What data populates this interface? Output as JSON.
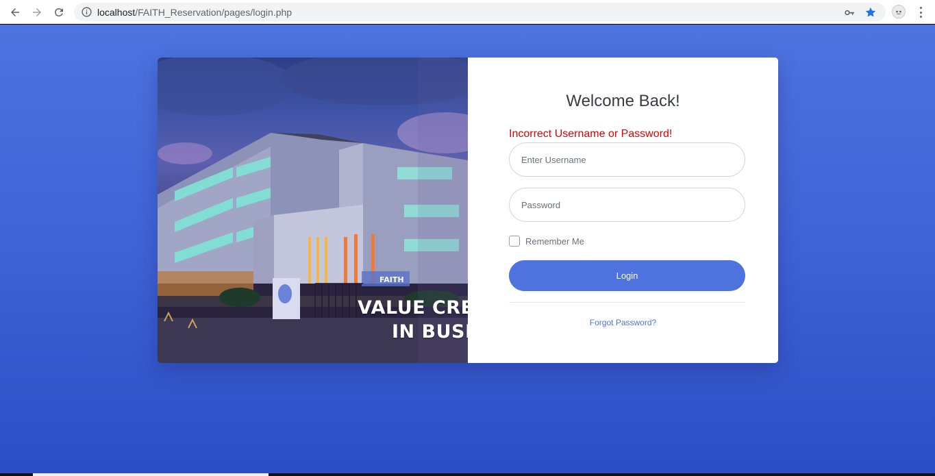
{
  "browser": {
    "url_host": "localhost",
    "url_path": "/FAITH_Reservation/pages/login.php",
    "icons": {
      "back": "back-arrow-icon",
      "forward": "forward-arrow-icon",
      "reload": "reload-icon",
      "info": "info-icon",
      "key": "key-icon",
      "bookmark": "star-icon",
      "profile": "profile-icon",
      "menu": "more-vert-icon"
    }
  },
  "colors": {
    "accent": "#4e73df",
    "error": "#e00000",
    "bookmark_star": "#1a73e8"
  },
  "hero": {
    "line1": "VALUE CREATI",
    "line2": "IN BUSINE",
    "sign_text": "FAITH"
  },
  "login": {
    "title": "Welcome Back!",
    "error": "Incorrect Username or Password!",
    "username_placeholder": "Enter Username",
    "password_placeholder": "Password",
    "remember_label": "Remember Me",
    "remember_checked": false,
    "submit_label": "Login",
    "forgot_label": "Forgot Password?"
  }
}
